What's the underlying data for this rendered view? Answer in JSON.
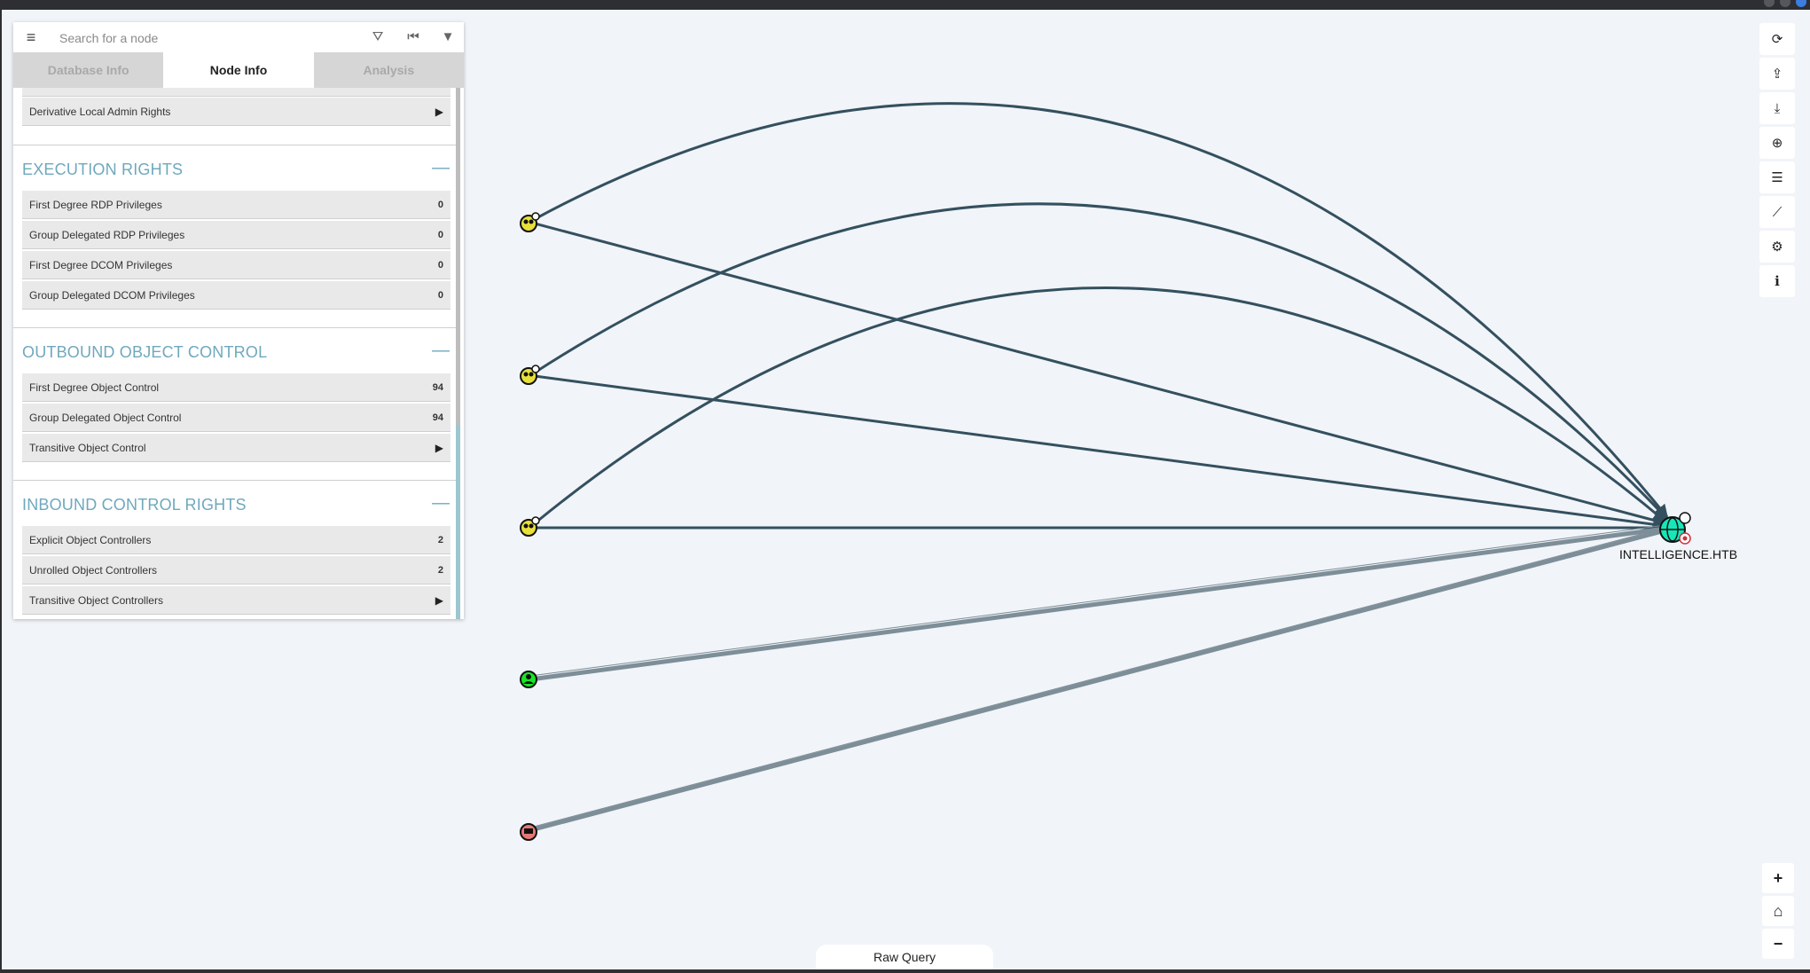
{
  "search": {
    "placeholder": "Search for a node",
    "menu_icon": "hamburger-icon",
    "path_icon": "road-icon",
    "back_icon": "step-backward-icon",
    "filter_icon": "filter-icon"
  },
  "tabs": [
    {
      "label": "Database Info"
    },
    {
      "label": "Node Info"
    },
    {
      "label": "Analysis"
    }
  ],
  "partial_row": {
    "label": "Derivative Local Admin Rights",
    "action": "▶"
  },
  "sections": {
    "execution": {
      "title": "EXECUTION RIGHTS",
      "collapse": "—",
      "rows": [
        {
          "label": "First Degree RDP Privileges",
          "value": "0"
        },
        {
          "label": "Group Delegated RDP Privileges",
          "value": "0"
        },
        {
          "label": "First Degree DCOM Privileges",
          "value": "0"
        },
        {
          "label": "Group Delegated DCOM Privileges",
          "value": "0"
        }
      ]
    },
    "outbound": {
      "title": "OUTBOUND OBJECT CONTROL",
      "collapse": "—",
      "rows": [
        {
          "label": "First Degree Object Control",
          "value": "94"
        },
        {
          "label": "Group Delegated Object Control",
          "value": "94"
        },
        {
          "label": "Transitive Object Control",
          "value": "▶"
        }
      ]
    },
    "inbound": {
      "title": "INBOUND CONTROL RIGHTS",
      "collapse": "—",
      "rows": [
        {
          "label": "Explicit Object Controllers",
          "value": "2"
        },
        {
          "label": "Unrolled Object Controllers",
          "value": "2"
        },
        {
          "label": "Transitive Object Controllers",
          "value": "▶"
        }
      ]
    }
  },
  "toolbar": {
    "icons": [
      "refresh-icon",
      "upload-icon",
      "download-icon",
      "import-icon",
      "query-list-icon",
      "chart-icon",
      "settings-icon",
      "info-icon"
    ],
    "glyphs": [
      "⟳",
      "⇪",
      "⤓",
      "⊕",
      "☰",
      "⟋",
      "⚙",
      "i"
    ]
  },
  "zoom": {
    "in": "+",
    "home": "⌂",
    "out": "−"
  },
  "raw_query": "Raw Query",
  "graph": {
    "domain_label": "INTELLIGENCE.HTB",
    "nodes": [
      "group",
      "group",
      "group",
      "user",
      "computer",
      "domain"
    ],
    "colors": {
      "group": "#e8e03a",
      "user": "#17e625",
      "computer": "#e67873",
      "domain": "#17e6b9",
      "edge_dark": "#34505f",
      "edge_light": "#7d8e98"
    }
  }
}
